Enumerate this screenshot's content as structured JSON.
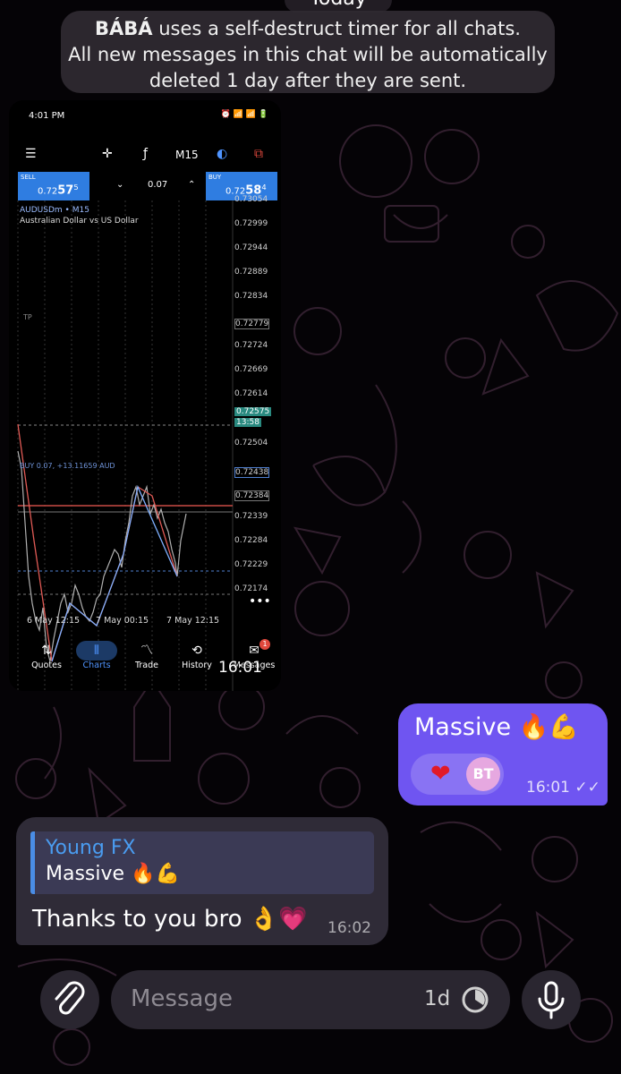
{
  "date_pill": "Today",
  "notice": {
    "name": "BÁBÁ",
    "line1_rest": " uses a self-destruct timer for all chats.",
    "line2": "All new messages in this chat will be automatically",
    "line3": "deleted 1 day after they are sent."
  },
  "screenshot": {
    "status_time": "4:01 PM",
    "timeframe": "M15",
    "sell_label": "SELL",
    "sell_price_main": "0.72",
    "sell_price_big": "57",
    "sell_price_sup": "5",
    "buy_label": "BUY",
    "buy_price_main": "0.72",
    "buy_price_big": "58",
    "buy_price_sup": "4",
    "lot": "0.07",
    "symbol": "AUDUSDm • M15",
    "symbol_desc": "Australian Dollar vs US Dollar",
    "tp_label": "TP",
    "position_line": "BUY 0.07, +13.11659 AUD",
    "price_ticks": [
      "0.73054",
      "0.72999",
      "0.72944",
      "0.72889",
      "0.72834",
      "0.72779",
      "0.72724",
      "0.72669",
      "0.72614",
      "0.72575",
      "13:58",
      "0.72504",
      "0.72438",
      "0.72384",
      "0.72339",
      "0.72284",
      "0.72229",
      "0.72174"
    ],
    "x_ticks": [
      "6 May 12:15",
      "7 May 00:15",
      "7 May 12:15"
    ],
    "nav": [
      {
        "label": "Quotes",
        "icon": "⇅"
      },
      {
        "label": "Charts",
        "icon": "⫴"
      },
      {
        "label": "Trade",
        "icon": "〽"
      },
      {
        "label": "History",
        "icon": "⟲"
      },
      {
        "label": "Messages",
        "icon": "✉"
      }
    ],
    "messages_badge": "1",
    "sent_time": "16:01"
  },
  "outgoing": {
    "text": "Massive 🔥💪",
    "reaction_heart": "❤",
    "reaction_avatar": "BT",
    "time": "16:01",
    "status": "✓✓"
  },
  "incoming": {
    "reply_name": "Young FX",
    "reply_text": "Massive 🔥💪",
    "text": "Thanks to you bro 👌💗",
    "time": "16:02"
  },
  "composer": {
    "placeholder": "Message",
    "timer": "1d"
  },
  "colors": {
    "outgoing_bubble": "#6f55f1",
    "incoming_bubble": "#2f2b37",
    "accent_blue": "#2f7de1"
  }
}
